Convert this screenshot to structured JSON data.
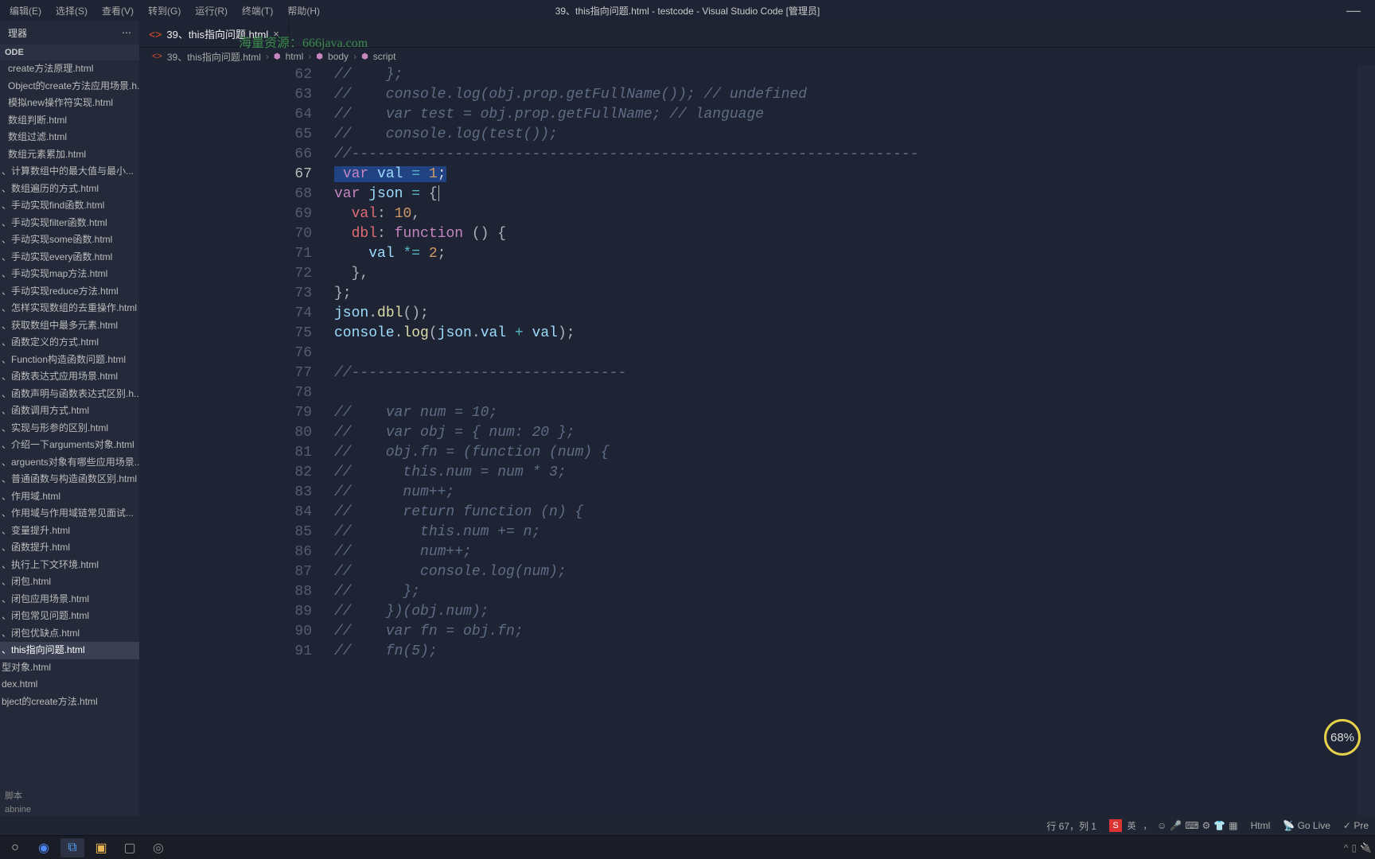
{
  "window_title": "39、this指向问题.html - testcode - Visual Studio Code [管理员]",
  "menus": [
    "编辑(E)",
    "选择(S)",
    "查看(V)",
    "转到(G)",
    "运行(R)",
    "终端(T)",
    "帮助(H)"
  ],
  "sidebar": {
    "header": "理器",
    "section": "ODE",
    "items": [
      {
        "label": "create方法原理.html",
        "level": 1
      },
      {
        "label": "Object的create方法应用场景.h...",
        "level": 1
      },
      {
        "label": "模拟new操作符实现.html",
        "level": 1
      },
      {
        "label": "数组判断.html",
        "level": 1
      },
      {
        "label": "数组过滤.html",
        "level": 1
      },
      {
        "label": "数组元素累加.html",
        "level": 1
      },
      {
        "label": "、计算数组中的最大值与最小...",
        "level": 0
      },
      {
        "label": "、数组遍历的方式.html",
        "level": 0
      },
      {
        "label": "、手动实现find函数.html",
        "level": 0
      },
      {
        "label": "、手动实现filter函数.html",
        "level": 0
      },
      {
        "label": "、手动实现some函数.html",
        "level": 0
      },
      {
        "label": "、手动实现every函数.html",
        "level": 0
      },
      {
        "label": "、手动实现map方法.html",
        "level": 0
      },
      {
        "label": "、手动实现reduce方法.html",
        "level": 0
      },
      {
        "label": "、怎样实现数组的去重操作.html",
        "level": 0
      },
      {
        "label": "、获取数组中最多元素.html",
        "level": 0
      },
      {
        "label": "、函数定义的方式.html",
        "level": 0
      },
      {
        "label": "、Function构造函数问题.html",
        "level": 0
      },
      {
        "label": "、函数表达式应用场景.html",
        "level": 0
      },
      {
        "label": "、函数声明与函数表达式区别.h...",
        "level": 0
      },
      {
        "label": "、函数调用方式.html",
        "level": 0
      },
      {
        "label": "、实现与形参的区别.html",
        "level": 0
      },
      {
        "label": "、介绍一下arguments对象.html",
        "level": 0
      },
      {
        "label": "、arguents对象有哪些应用场景...",
        "level": 0
      },
      {
        "label": "、普通函数与构造函数区别.html",
        "level": 0
      },
      {
        "label": "、作用域.html",
        "level": 0
      },
      {
        "label": "、作用域与作用域链常见面试...",
        "level": 0
      },
      {
        "label": "、变量提升.html",
        "level": 0
      },
      {
        "label": "、函数提升.html",
        "level": 0
      },
      {
        "label": "、执行上下文环境.html",
        "level": 0
      },
      {
        "label": "、闭包.html",
        "level": 0
      },
      {
        "label": "、闭包应用场景.html",
        "level": 0
      },
      {
        "label": "、闭包常见问题.html",
        "level": 0
      },
      {
        "label": "、闭包优缺点.html",
        "level": 0
      },
      {
        "label": "、this指向问题.html",
        "level": 0,
        "active": true
      },
      {
        "label": "型对象.html",
        "level": 0
      },
      {
        "label": "dex.html",
        "level": 0
      },
      {
        "label": "bject的create方法.html",
        "level": 0
      }
    ],
    "outline": "脚本",
    "tabnine": "abnine"
  },
  "tab": {
    "label": "39、this指向问题.html",
    "iconText": "<>"
  },
  "watermark": "海量资源：666java.com",
  "breadcrumbs": [
    "39、this指向问题.html",
    "html",
    "body",
    "script"
  ],
  "line_start": 62,
  "line_cur": 67,
  "line_end": 91,
  "code_lines": [
    {
      "n": 62,
      "h": "<span class='c-com'>//    };</span>"
    },
    {
      "n": 63,
      "h": "<span class='c-com'>//    console.log(obj.prop.getFullName()); // undefined</span>"
    },
    {
      "n": 64,
      "h": "<span class='c-com'>//    var test = obj.prop.getFullName; // language</span>"
    },
    {
      "n": 65,
      "h": "<span class='c-com'>//    console.log(test());</span>"
    },
    {
      "n": 66,
      "h": "<span class='c-com'>//------------------------------------------------------------------</span>"
    },
    {
      "n": 67,
      "h": "<span class='sel'> <span class='c-kw'>var</span> <span class='c-var'>val</span> <span class='c-op'>=</span> <span class='c-num'>1</span>;</span>"
    },
    {
      "n": 68,
      "h": "<span class='c-kw'>var</span> <span class='c-var'>json</span> <span class='c-op'>=</span> <span class='c-punc'>{</span><span class='cursor-caret'></span>"
    },
    {
      "n": 69,
      "h": "  <span class='c-prop'>val</span><span class='c-punc'>:</span> <span class='c-num'>10</span><span class='c-punc'>,</span>"
    },
    {
      "n": 70,
      "h": "  <span class='c-prop'>dbl</span><span class='c-punc'>:</span> <span class='c-kw'>function</span> <span class='c-punc'>() {</span>"
    },
    {
      "n": 71,
      "h": "    <span class='c-var'>val</span> <span class='c-op'>*=</span> <span class='c-num'>2</span><span class='c-punc'>;</span>"
    },
    {
      "n": 72,
      "h": "  <span class='c-punc'>},</span>"
    },
    {
      "n": 73,
      "h": "<span class='c-punc'>};</span>"
    },
    {
      "n": 74,
      "h": "<span class='c-var'>json</span><span class='c-punc'>.</span><span class='c-fn'>dbl</span><span class='c-punc'>();</span>"
    },
    {
      "n": 75,
      "h": "<span class='c-var'>console</span><span class='c-punc'>.</span><span class='c-fn'>log</span><span class='c-punc'>(</span><span class='c-var'>json</span><span class='c-punc'>.</span><span class='c-var'>val</span> <span class='c-op'>+</span> <span class='c-var'>val</span><span class='c-punc'>);</span>"
    },
    {
      "n": 76,
      "h": ""
    },
    {
      "n": 77,
      "h": "<span class='c-com'>//--------------------------------</span>"
    },
    {
      "n": 78,
      "h": ""
    },
    {
      "n": 79,
      "h": "<span class='c-com'>//    var num = 10;</span>"
    },
    {
      "n": 80,
      "h": "<span class='c-com'>//    var obj = { num: 20 };</span>"
    },
    {
      "n": 81,
      "h": "<span class='c-com'>//    obj.fn = (function (num) {</span>"
    },
    {
      "n": 82,
      "h": "<span class='c-com'>//      this.num = num * 3;</span>"
    },
    {
      "n": 83,
      "h": "<span class='c-com'>//      num++;</span>"
    },
    {
      "n": 84,
      "h": "<span class='c-com'>//      return function (n) {</span>"
    },
    {
      "n": 85,
      "h": "<span class='c-com'>//        this.num += n;</span>"
    },
    {
      "n": 86,
      "h": "<span class='c-com'>//        num++;</span>"
    },
    {
      "n": 87,
      "h": "<span class='c-com'>//        console.log(num);</span>"
    },
    {
      "n": 88,
      "h": "<span class='c-com'>//      };</span>"
    },
    {
      "n": 89,
      "h": "<span class='c-com'>//    })(obj.num);</span>"
    },
    {
      "n": 90,
      "h": "<span class='c-com'>//    var fn = obj.fn;</span>"
    },
    {
      "n": 91,
      "h": "<span class='c-com'>//    fn(5);</span>"
    }
  ],
  "badge": "68%",
  "status": {
    "pos": "行 67，列 1",
    "lang": "Html",
    "golive": "Go Live",
    "pre": "Pre"
  },
  "ime": {
    "logo": "S",
    "lang": "英",
    "dot": "，"
  }
}
